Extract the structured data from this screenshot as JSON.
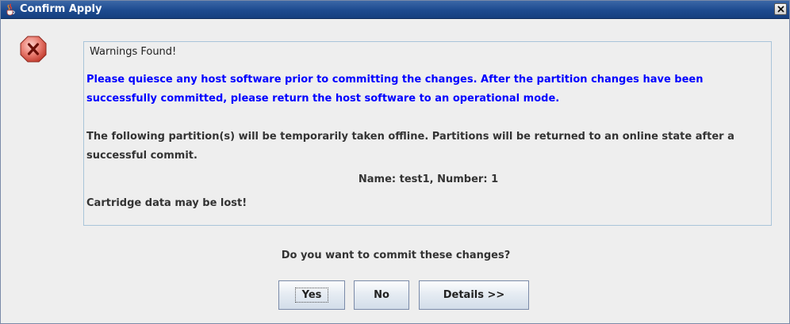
{
  "window": {
    "title": "Confirm Apply",
    "close_label": "×"
  },
  "warnings": {
    "header": "Warnings Found!",
    "quiesce_message": "Please quiesce any host software prior to committing the changes. After the partition changes have been successfully committed, please return the host software to an operational mode.",
    "offline_message": "The following partition(s) will be temporarily taken offline. Partitions will be returned to an online state after a successful commit.",
    "partition_line": "Name: test1,  Number: 1",
    "cartridge_message": "Cartridge data may be lost!"
  },
  "prompt": {
    "question": "Do you want to commit these changes?"
  },
  "buttons": {
    "yes": "Yes",
    "no": "No",
    "details": "Details >>"
  },
  "colors": {
    "titlebar": "#1d4a8f",
    "warning_text": "#0000ff",
    "error_icon": "#d9534f"
  },
  "icons": {
    "window_icon": "java-cup-icon",
    "error_icon": "error-x-octagon-icon",
    "close_icon": "close-x-icon"
  }
}
